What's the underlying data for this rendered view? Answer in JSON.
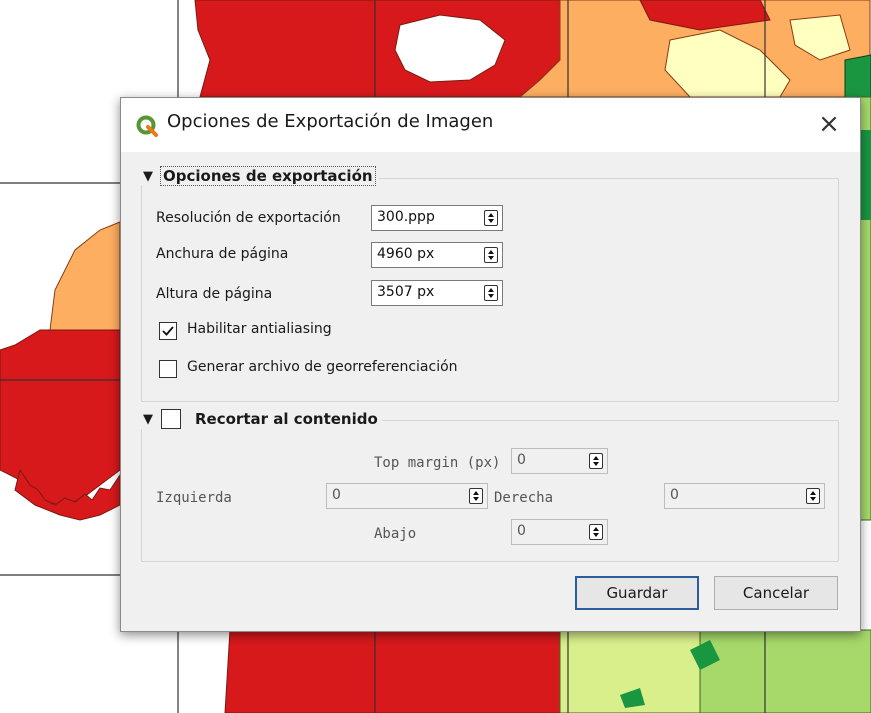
{
  "dialog": {
    "title": "Opciones de Exportación de Imagen",
    "close_symbol": "×",
    "icon": "qgis-logo"
  },
  "export_options": {
    "section_title": "Opciones de exportación",
    "expanded": true,
    "resolution_label": "Resolución de exportación",
    "resolution_value": "300.ppp",
    "page_width_label": "Anchura de página",
    "page_width_value": "4960 px",
    "page_height_label": "Altura de página",
    "page_height_value": "3507 px",
    "antialiasing_label": "Habilitar antialiasing",
    "antialiasing_checked": true,
    "georef_label": "Generar archivo de georreferenciación",
    "georef_checked": false
  },
  "crop": {
    "section_title": "Recortar al contenido",
    "checked": false,
    "top_label": "Top margin (px)",
    "top_value": "0",
    "left_label": "Izquierda",
    "left_value": "0",
    "right_label": "Derecha",
    "right_value": "0",
    "bottom_label": "Abajo",
    "bottom_value": "0"
  },
  "buttons": {
    "save": "Guardar",
    "cancel": "Cancelar"
  },
  "colors": {
    "dark_red": "#d7191c",
    "orange": "#fdae61",
    "light_yellow": "#ffffbf",
    "light_green": "#a6d96a",
    "dark_green": "#1a9641",
    "accent_blue": "#2c5d9f"
  }
}
